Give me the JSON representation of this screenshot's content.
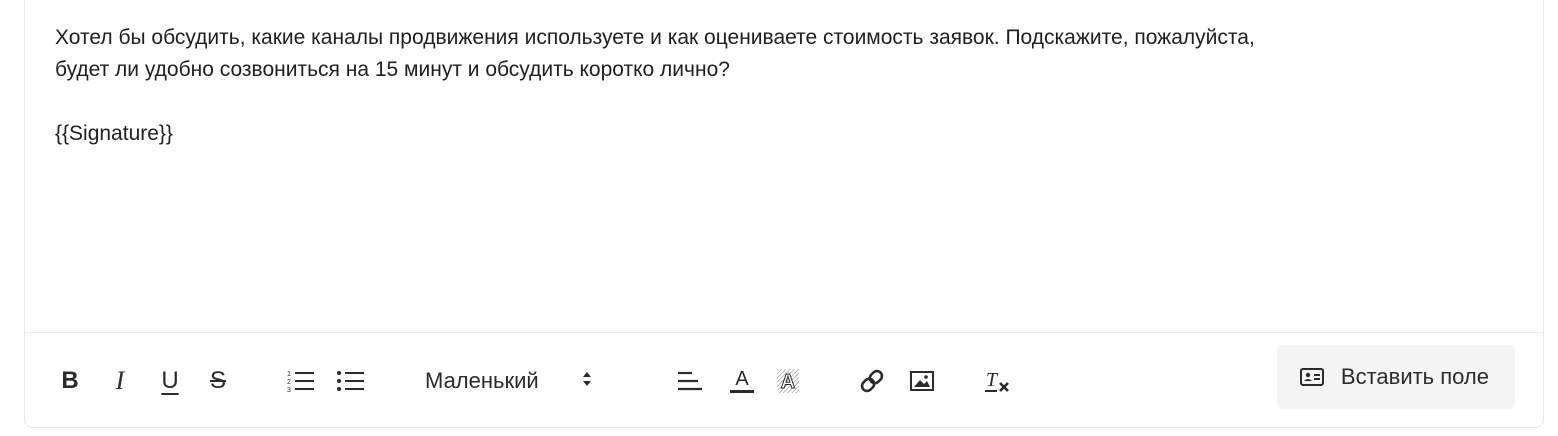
{
  "editor": {
    "paragraphs": [
      "Хотел бы обсудить, какие каналы продвижения используете и как оцениваете стоимость заявок.  Подскажите, пожалуйста,",
      "будет ли удобно созвониться на 15 минут и обсудить коротко лично?"
    ],
    "signature": "{{Signature}}"
  },
  "toolbar": {
    "bold_label": "B",
    "italic_label": "I",
    "underline_label": "U",
    "strike_label": "S",
    "font_size_value": "Маленький",
    "insert_field_label": "Вставить поле",
    "icons": [
      "bold-icon",
      "italic-icon",
      "underline-icon",
      "strikethrough-icon",
      "ordered-list-icon",
      "bullet-list-icon",
      "select-arrows-icon",
      "align-icon",
      "text-color-icon",
      "highlight-color-icon",
      "link-icon",
      "image-icon",
      "clear-format-icon",
      "id-card-icon"
    ]
  }
}
